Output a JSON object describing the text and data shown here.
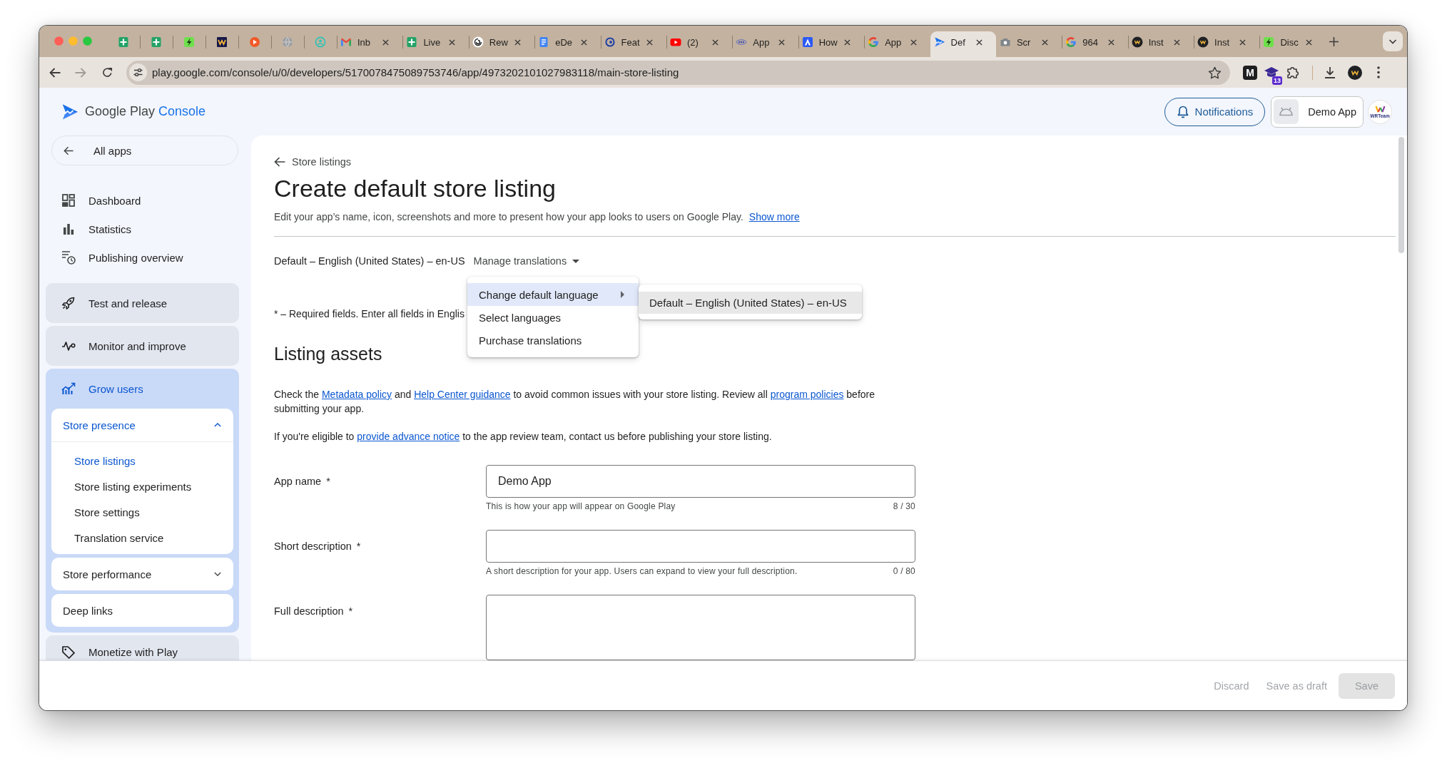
{
  "browser": {
    "tabs": [
      {
        "kind": "grid",
        "selected": false
      },
      {
        "kind": "grid",
        "selected": false
      },
      {
        "kind": "bolt",
        "selected": false
      },
      {
        "kind": "zigzag",
        "selected": false
      },
      {
        "kind": "dot",
        "selected": false
      },
      {
        "kind": "globe",
        "selected": false
      },
      {
        "kind": "ring",
        "selected": false
      },
      {
        "kind": "mail",
        "title": "Inb",
        "selected": false
      },
      {
        "kind": "grid",
        "title": "Live",
        "selected": false
      },
      {
        "kind": "knot",
        "title": "Rew",
        "selected": false
      },
      {
        "kind": "doc",
        "title": "eDe",
        "selected": false
      },
      {
        "kind": "swirl",
        "title": "Feat",
        "selected": false
      },
      {
        "kind": "video",
        "title": "(2)",
        "selected": false
      },
      {
        "kind": "dots",
        "title": "App",
        "selected": false
      },
      {
        "kind": "triangle",
        "title": "How",
        "selected": false
      },
      {
        "kind": "gring",
        "title": "App",
        "selected": false
      },
      {
        "kind": "play",
        "title": "Def",
        "selected": true
      },
      {
        "kind": "camera",
        "title": "Scr",
        "selected": false
      },
      {
        "kind": "gring",
        "title": "964",
        "selected": false
      },
      {
        "kind": "orb",
        "title": "Inst",
        "selected": false
      },
      {
        "kind": "orb",
        "title": "Inst",
        "selected": false
      },
      {
        "kind": "bolt",
        "title": "Disc",
        "selected": false
      }
    ],
    "url": "play.google.com/console/u/0/developers/5170078475089753746/app/4973202101027983118/main-store-listing",
    "extensions": [
      {
        "kind": "letter",
        "text": "M"
      },
      {
        "kind": "cap",
        "badge": "13"
      },
      {
        "kind": "puzzle"
      }
    ]
  },
  "header": {
    "product": {
      "name": "Google Play",
      "suffix": "Console"
    },
    "notifications": "Notifications",
    "app": "Demo App",
    "avatar": "WRTeam"
  },
  "sidebar": {
    "back": "All apps",
    "links": [
      {
        "label": "Dashboard"
      },
      {
        "label": "Statistics"
      },
      {
        "label": "Publishing overview"
      }
    ],
    "sections": [
      {
        "label": "Test and release",
        "selected": false
      },
      {
        "label": "Monitor and improve",
        "selected": false
      },
      {
        "label": "Grow users",
        "selected": true,
        "children": [
          {
            "label": "Store presence",
            "expanded": true,
            "children": [
              {
                "label": "Store listings",
                "selected": true
              },
              {
                "label": "Store listing experiments",
                "selected": false
              },
              {
                "label": "Store settings",
                "selected": false
              },
              {
                "label": "Translation service",
                "selected": false
              }
            ]
          },
          {
            "label": "Store performance",
            "expanded": false
          },
          {
            "label": "Deep links"
          }
        ]
      },
      {
        "label": "Monetize with Play",
        "selected": false
      }
    ]
  },
  "page": {
    "back": "Store listings",
    "title": "Create default store listing",
    "description": "Edit your app’s name, icon, screenshots and more to present how your app looks to users on Google Play.",
    "description_link": "Show more",
    "language": "Default – English (United States) – en-US",
    "manage": {
      "label": "Manage translations",
      "expanded": true
    },
    "menu": [
      {
        "kind": "submenu",
        "label": "Change default language",
        "selected": true,
        "children": [
          {
            "label": "Default – English (United States) – en-US",
            "selected": true
          }
        ]
      },
      {
        "kind": "item",
        "label": "Select languages",
        "selected": false
      },
      {
        "kind": "item",
        "label": "Purchase translations",
        "selected": false
      }
    ],
    "required_note": "* – Required fields. Enter all fields in Englis",
    "section_title": "Listing assets",
    "paragraphs": [
      [
        {
          "kind": "text",
          "text": "Check the "
        },
        {
          "kind": "link",
          "text": "Metadata policy"
        },
        {
          "kind": "text",
          "text": " and "
        },
        {
          "kind": "link",
          "text": "Help Center guidance"
        },
        {
          "kind": "text",
          "text": " to avoid common issues with your store listing. Review all "
        },
        {
          "kind": "link",
          "text": "program policies"
        },
        {
          "kind": "text",
          "text": " before submitting your app."
        }
      ],
      [
        {
          "kind": "text",
          "text": "If you're eligible to "
        },
        {
          "kind": "link",
          "text": "provide advance notice"
        },
        {
          "kind": "text",
          "text": " to the app review team, contact us before publishing your store listing."
        }
      ]
    ],
    "fields": [
      {
        "kind": "input",
        "label": "App name",
        "mark": "*",
        "value": "Demo App",
        "hint": "This is how your app will appear on Google Play",
        "counter": "8 / 30"
      },
      {
        "kind": "input",
        "label": "Short description",
        "mark": "*",
        "hint": "A short description for your app. Users can expand to view your full description.",
        "counter": "0 / 80"
      },
      {
        "kind": "textarea",
        "label": "Full description",
        "mark": "*"
      }
    ]
  },
  "footer": {
    "buttons": [
      {
        "kind": "text",
        "label": "Discard",
        "disabled": true
      },
      {
        "kind": "text",
        "label": "Save as draft",
        "disabled": true
      },
      {
        "kind": "filled",
        "label": "Save",
        "disabled": true
      }
    ]
  }
}
